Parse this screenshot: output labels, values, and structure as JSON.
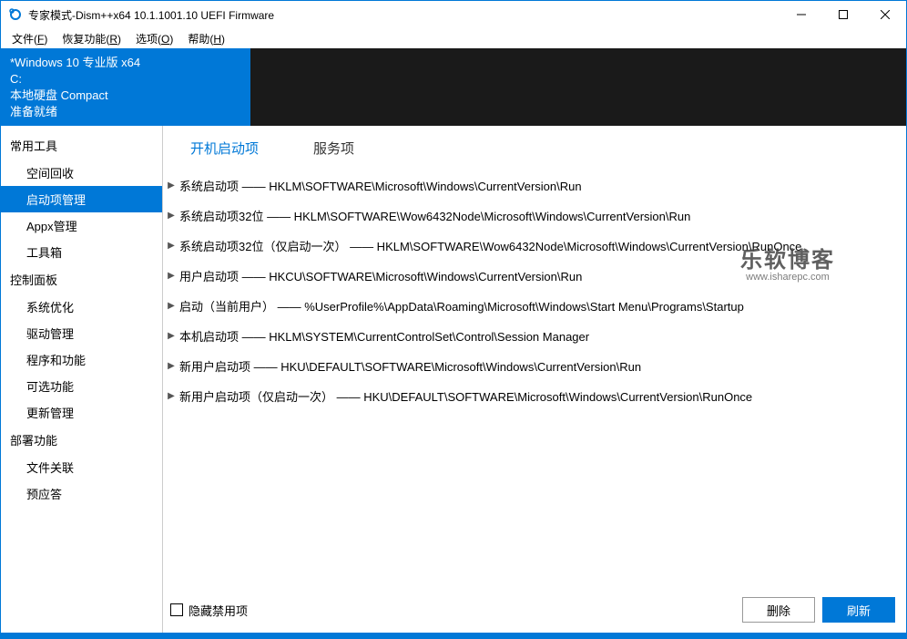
{
  "window": {
    "title": "专家模式-Dism++x64 10.1.1001.10 UEFI Firmware"
  },
  "menu": {
    "file": "文件(",
    "file_u": "F",
    "file_r": ")",
    "recover": "恢复功能(",
    "recover_u": "R",
    "recover_r": ")",
    "options": "选项(",
    "options_u": "O",
    "options_r": ")",
    "help": "帮助(",
    "help_u": "H",
    "help_r": ")"
  },
  "os_panel": {
    "name": "*Windows 10 专业版 x64",
    "drive": "C:",
    "disk": "本地硬盘 Compact",
    "status": "准备就绪"
  },
  "sidebar": {
    "sections": [
      {
        "title": "常用工具",
        "items": [
          "空间回收",
          "启动项管理",
          "Appx管理",
          "工具箱"
        ],
        "selected": 1
      },
      {
        "title": "控制面板",
        "items": [
          "系统优化",
          "驱动管理",
          "程序和功能",
          "可选功能",
          "更新管理"
        ]
      },
      {
        "title": "部署功能",
        "items": [
          "文件关联",
          "预应答"
        ]
      }
    ]
  },
  "tabs": [
    "开机启动项",
    "服务项"
  ],
  "active_tab": 0,
  "startup_rows": [
    "系统启动项 —— HKLM\\SOFTWARE\\Microsoft\\Windows\\CurrentVersion\\Run",
    "系统启动项32位 —— HKLM\\SOFTWARE\\Wow6432Node\\Microsoft\\Windows\\CurrentVersion\\Run",
    "系统启动项32位（仅启动一次） —— HKLM\\SOFTWARE\\Wow6432Node\\Microsoft\\Windows\\CurrentVersion\\RunOnce",
    "用户启动项 —— HKCU\\SOFTWARE\\Microsoft\\Windows\\CurrentVersion\\Run",
    "启动（当前用户） —— %UserProfile%\\AppData\\Roaming\\Microsoft\\Windows\\Start Menu\\Programs\\Startup",
    "本机启动项 —— HKLM\\SYSTEM\\CurrentControlSet\\Control\\Session Manager",
    "新用户启动项 —— HKU\\DEFAULT\\SOFTWARE\\Microsoft\\Windows\\CurrentVersion\\Run",
    "新用户启动项（仅启动一次） —— HKU\\DEFAULT\\SOFTWARE\\Microsoft\\Windows\\CurrentVersion\\RunOnce"
  ],
  "footer": {
    "hide_disabled": "隐藏禁用项",
    "delete": "删除",
    "refresh": "刷新"
  },
  "watermark": {
    "line1": "乐软博客",
    "line2": "www.isharepc.com"
  }
}
